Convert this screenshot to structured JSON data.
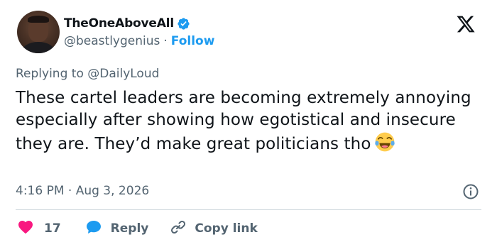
{
  "user": {
    "display_name": "TheOneAboveAll",
    "handle": "@beastlygenius",
    "separator": "·",
    "follow_label": "Follow",
    "verified": true
  },
  "tweet": {
    "reply_prefix": "Replying to",
    "reply_handle": "@DailyLoud",
    "text": "These cartel leaders are becoming extremely annoying especially after showing how egotistical and insecure they are. They’d make great politicians tho",
    "emoji": "face-with-tears-of-joy",
    "timestamp": "4:16 PM · Aug 3, 2026"
  },
  "actions": {
    "like_count": "17",
    "reply_label": "Reply",
    "copy_link_label": "Copy link"
  },
  "colors": {
    "accent": "#1d9bf0",
    "like": "#f91880",
    "muted": "#536471",
    "text": "#0f1419",
    "divider": "#cfd9de"
  },
  "icons": [
    "verified-badge-icon",
    "x-logo-icon",
    "info-icon",
    "heart-icon",
    "reply-bubble-icon",
    "link-icon"
  ]
}
